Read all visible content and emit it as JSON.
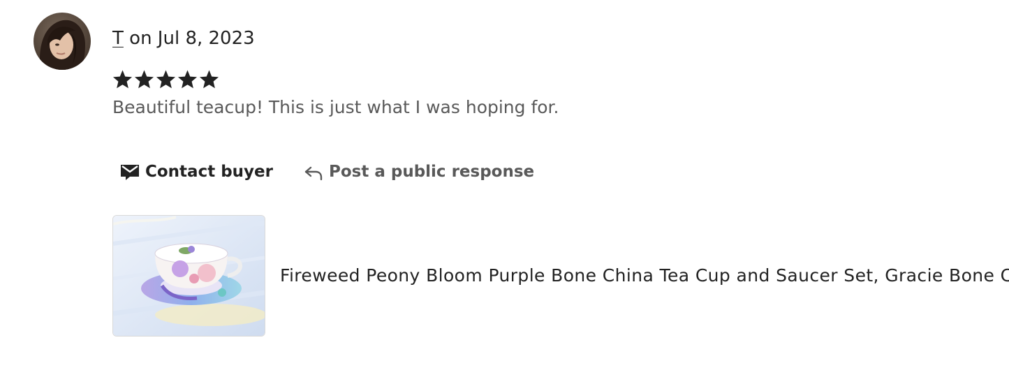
{
  "review": {
    "reviewer_name": "T",
    "date_text": "on Jul 8, 2023",
    "rating": 5,
    "rating_max": 5,
    "text": "Beautiful teacup! This is just what I was hoping for."
  },
  "actions": {
    "contact_label": "Contact buyer",
    "contact_icon": "mail-icon",
    "respond_label": "Post a public response",
    "respond_icon": "reply-arrow-icon"
  },
  "listing": {
    "title": "Fireweed Peony Bloom Purple Bone China Tea Cup and Saucer Set, Gracie Bone China"
  },
  "colors": {
    "primary_text": "#222222",
    "secondary_text": "#595959",
    "star": "#222222"
  }
}
